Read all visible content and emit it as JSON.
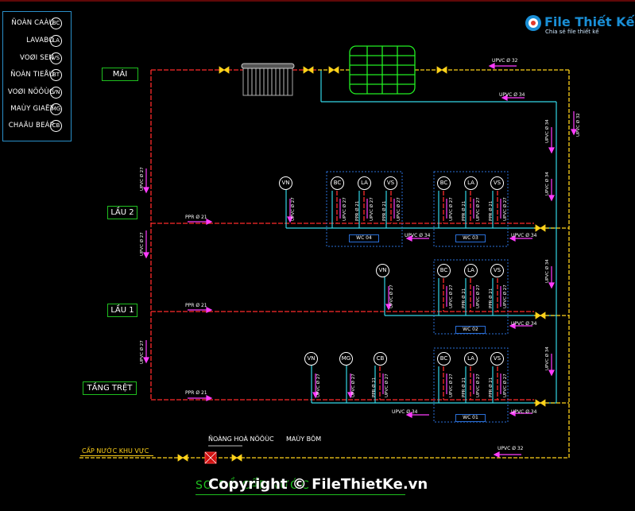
{
  "legend": [
    {
      "text": "ÑOÀN CAÀU",
      "code": "BC"
    },
    {
      "text": "LAVABO",
      "code": "LA"
    },
    {
      "text": "VOØI SEN",
      "code": "VS"
    },
    {
      "text": "ÑOÀN TIEÅU",
      "code": "BT"
    },
    {
      "text": "VOØI NÖÔÙC",
      "code": "VN"
    },
    {
      "text": "MAÙY GIAËT",
      "code": "MG"
    },
    {
      "text": "CHAÄU BEÁP",
      "code": "CB"
    }
  ],
  "levels": {
    "mai": "MÁI",
    "lau2": "LẦU 2",
    "lau1": "LẦU 1",
    "tret": "TẦNG TRỆT"
  },
  "wc": {
    "wc04": "WC 04",
    "wc03": "WC 03",
    "wc02": "WC 02",
    "wc01": "WC 01"
  },
  "pipe_labels": {
    "upvc32": "UPVC Ø 32",
    "upvc34": "UPVC Ø 34",
    "upvc27": "UPVC Ø 27",
    "ppr21": "PPR Ø 21"
  },
  "annotations": {
    "meter": "ÑOÀNG HOÀ NÖÔÙC",
    "pump": "MAÙY BÔM",
    "supply": "CẤP NƯỚC KHU VỰC"
  },
  "watermark": {
    "brand": "File Thiết Kế .vn",
    "sub": "Chia sẻ file thiết kế"
  },
  "title_partial": "SƠ ĐỒ CẤP NƯỚC",
  "copyright": "Copyright © FileThietKe.vn",
  "devices": {
    "vn": "VN",
    "bc": "BC",
    "la": "LA",
    "vs": "VS",
    "mg": "MG",
    "cb": "CB"
  },
  "colors": {
    "hot": "#ff2a2a",
    "cold": "#33d6e6",
    "frame": "#ffd21a",
    "label": "#ff3cff",
    "wc": "#2a6fd8",
    "level": "#1fbf1f"
  }
}
